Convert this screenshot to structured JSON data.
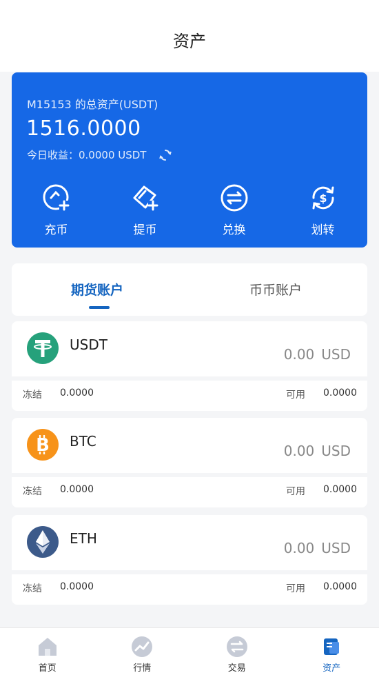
{
  "header": {
    "title": "资产"
  },
  "asset": {
    "label": "M15153 的总资产(USDT)",
    "total": "1516.0000",
    "earnings": "今日收益：0.0000 USDT"
  },
  "actions": [
    {
      "label": "充币",
      "icon": "deposit-icon"
    },
    {
      "label": "提币",
      "icon": "withdraw-icon"
    },
    {
      "label": "兑换",
      "icon": "exchange-icon"
    },
    {
      "label": "划转",
      "icon": "transfer-icon"
    }
  ],
  "tabs": {
    "futures": "期货账户",
    "spot": "币币账户",
    "active": "futures"
  },
  "accounts": [
    {
      "coin": "USDT",
      "value": "0.00",
      "unit": "USD",
      "frozen_label": "冻结",
      "frozen": "0.0000",
      "avail_label": "可用",
      "available": "0.0000",
      "color": "#26a17b"
    },
    {
      "coin": "BTC",
      "value": "0.00",
      "unit": "USD",
      "frozen_label": "冻结",
      "frozen": "0.0000",
      "avail_label": "可用",
      "available": "0.0000",
      "color": "#f7931a"
    },
    {
      "coin": "ETH",
      "value": "0.00",
      "unit": "USD",
      "frozen_label": "冻结",
      "frozen": "0.0000",
      "avail_label": "可用",
      "available": "0.0000",
      "color": "#3c5a8a"
    }
  ],
  "tabbar": [
    {
      "label": "首页",
      "icon": "home-icon"
    },
    {
      "label": "行情",
      "icon": "market-icon"
    },
    {
      "label": "交易",
      "icon": "trade-icon"
    },
    {
      "label": "资产",
      "icon": "assets-icon",
      "active": true
    }
  ],
  "colors": {
    "primary": "#1668e6",
    "accent": "#1565c0",
    "background": "#f4f5f7"
  }
}
